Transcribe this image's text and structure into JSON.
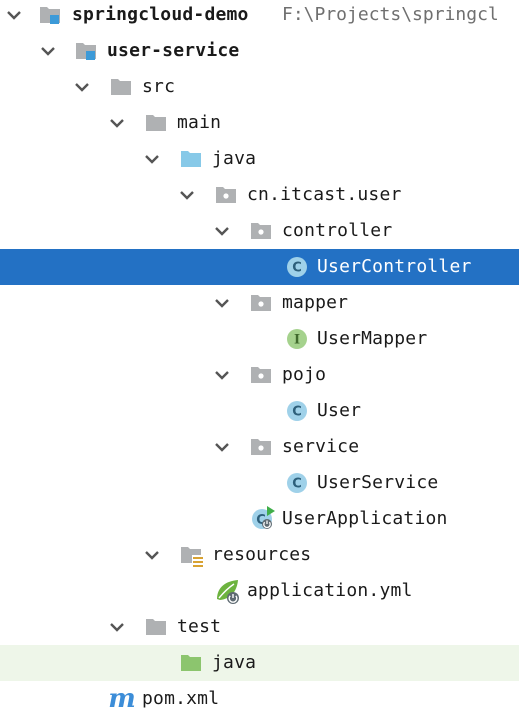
{
  "tree": {
    "root": {
      "label": "springcloud-demo",
      "path": "F:\\Projects\\springcl"
    },
    "module": {
      "label": "user-service"
    },
    "src": {
      "label": "src"
    },
    "main": {
      "label": "main"
    },
    "java": {
      "label": "java"
    },
    "package": {
      "label": "cn.itcast.user"
    },
    "controller": {
      "label": "controller"
    },
    "user_controller": {
      "label": "UserController",
      "icon_letter": "C"
    },
    "mapper": {
      "label": "mapper"
    },
    "user_mapper": {
      "label": "UserMapper",
      "icon_letter": "I"
    },
    "pojo": {
      "label": "pojo"
    },
    "user": {
      "label": "User",
      "icon_letter": "C"
    },
    "service": {
      "label": "service"
    },
    "user_service": {
      "label": "UserService",
      "icon_letter": "C"
    },
    "user_application": {
      "label": "UserApplication",
      "icon_letter": "C"
    },
    "resources": {
      "label": "resources"
    },
    "application_yml": {
      "label": "application.yml"
    },
    "test": {
      "label": "test"
    },
    "test_java": {
      "label": "java"
    },
    "pom": {
      "label": "pom.xml"
    }
  },
  "colors": {
    "selection": "#2371c4",
    "hover_row": "#eef6e9",
    "folder_gray": "#afb1b3",
    "folder_source_blue": "#87c9e8",
    "folder_test_green": "#8cc56e",
    "module_badge_blue": "#3c9ad8",
    "class_icon": "#9fd1e9",
    "interface_icon": "#a5d28d",
    "maven_icon": "#3c8dd8"
  }
}
